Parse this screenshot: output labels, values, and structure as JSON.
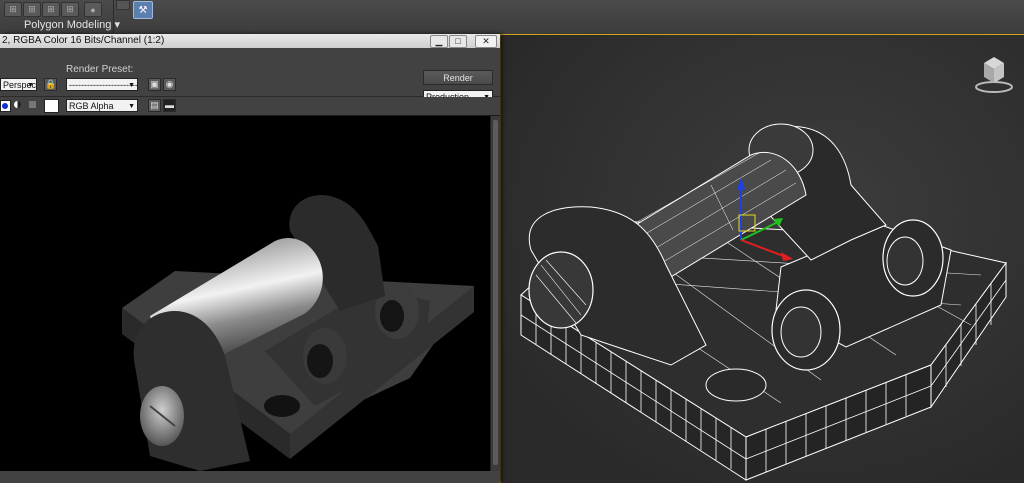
{
  "ribbon": {
    "label": "Polygon Modeling",
    "label_arrow": "▾",
    "active_tool_icon": "wrench-icon"
  },
  "render_window": {
    "title": "2, RGBA Color 16 Bits/Channel (1:2)",
    "area_label": "Perspec",
    "preset_label": "Render Preset:",
    "preset_value": "--------------------------",
    "render_button": "Render",
    "mode_value": "Production",
    "channel_value": "RGB Alpha",
    "window_buttons": [
      "▁",
      "□",
      "✕"
    ]
  },
  "colors": {
    "accent_border": "#d4a020",
    "viewport_bg": "#333333",
    "render_bg": "#000000",
    "gizmo_x": "#e02020",
    "gizmo_y": "#20c020",
    "gizmo_z": "#2040e0"
  }
}
